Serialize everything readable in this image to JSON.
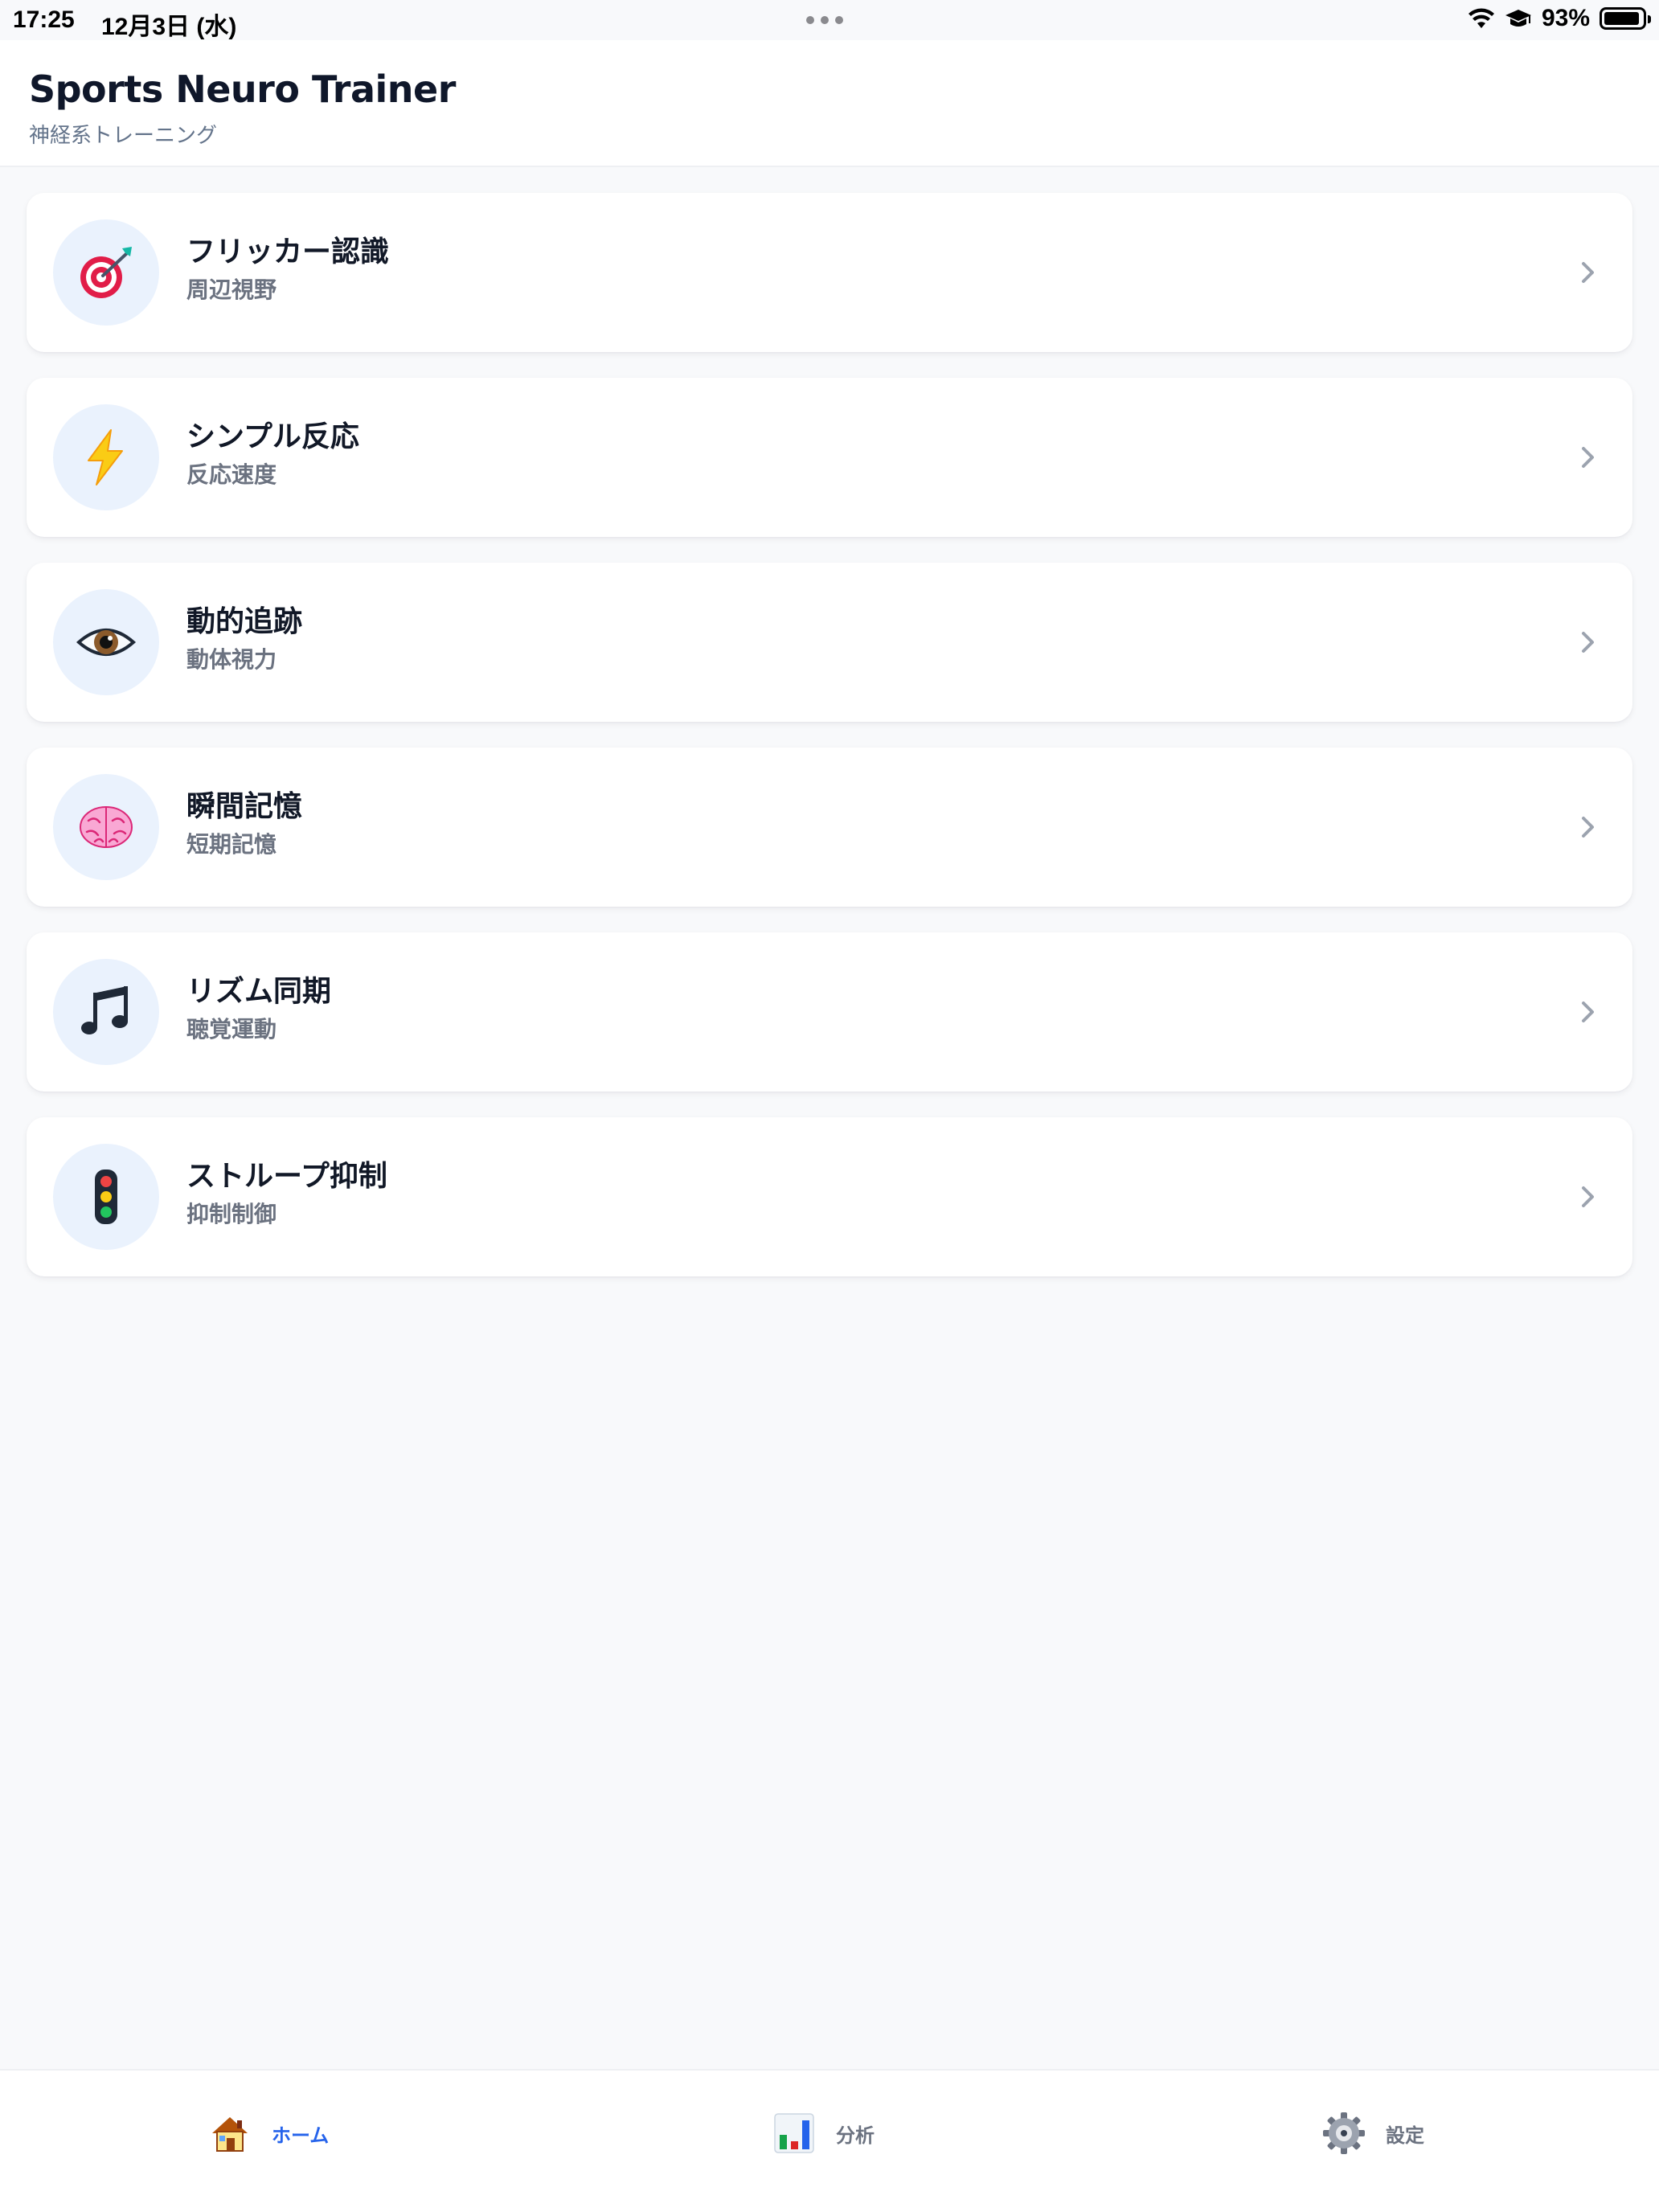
{
  "status_bar": {
    "time": "17:25",
    "date": "12月3日 (水)",
    "battery": "93%",
    "battery_level": 0.93
  },
  "header": {
    "title": "Sports Neuro Trainer",
    "subtitle": "神経系トレーニング"
  },
  "trainings": [
    {
      "title": "フリッカー認識",
      "subtitle": "周辺視野",
      "icon": "target-icon"
    },
    {
      "title": "シンプル反応",
      "subtitle": "反応速度",
      "icon": "lightning-icon"
    },
    {
      "title": "動的追跡",
      "subtitle": "動体視力",
      "icon": "eye-icon"
    },
    {
      "title": "瞬間記憶",
      "subtitle": "短期記憶",
      "icon": "brain-icon"
    },
    {
      "title": "リズム同期",
      "subtitle": "聴覚運動",
      "icon": "music-note-icon"
    },
    {
      "title": "ストループ抑制",
      "subtitle": "抑制制御",
      "icon": "traffic-light-icon"
    }
  ],
  "tabs": [
    {
      "label": "ホーム",
      "icon": "house-icon",
      "active": true
    },
    {
      "label": "分析",
      "icon": "bar-chart-icon",
      "active": false
    },
    {
      "label": "設定",
      "icon": "gear-icon",
      "active": false
    }
  ],
  "colors": {
    "accent": "#2563eb",
    "icon_circle": "#eaf2fd",
    "background": "#f8f9fb"
  }
}
